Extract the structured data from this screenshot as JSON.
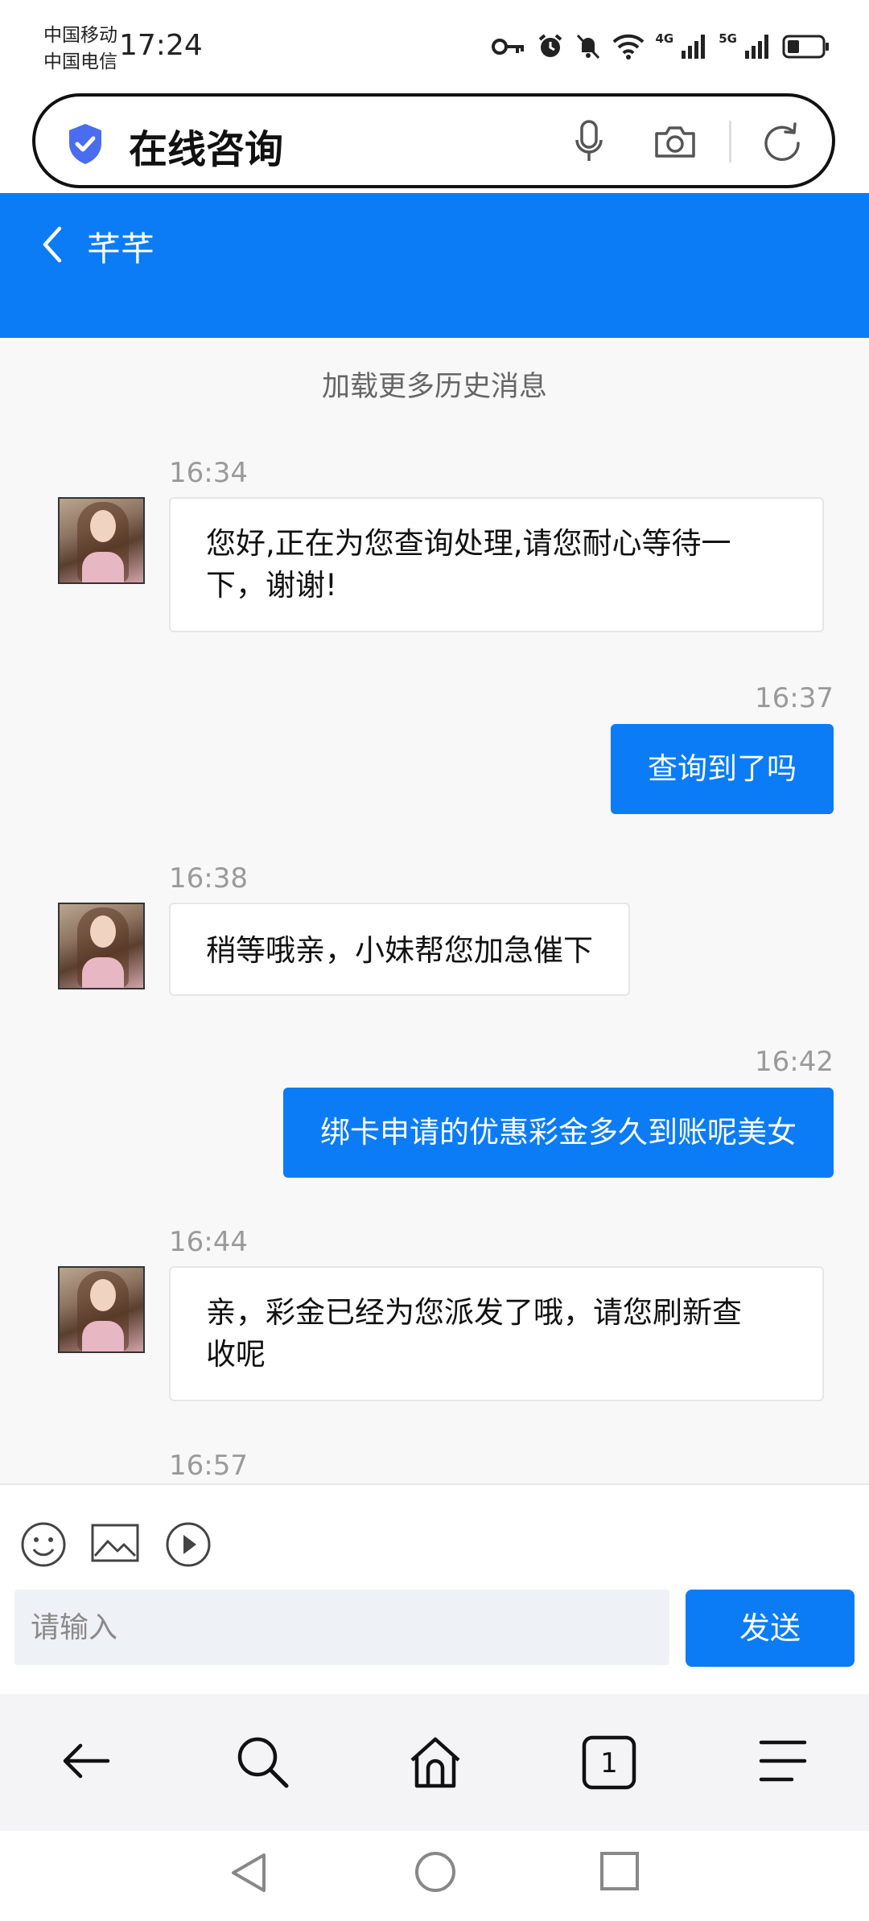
{
  "status_bar": {
    "carrier1": "中国移动",
    "carrier2": "中国电信",
    "time": "17:24",
    "net1": "4G",
    "net2": "5G"
  },
  "browser": {
    "url_text": "在线咨询"
  },
  "chat": {
    "title": "芊芊",
    "load_more": "加载更多历史消息",
    "messages": [
      {
        "from": "agent",
        "time": "16:34",
        "lines": [
          "您好,正在为您查询处理,请您耐心等待一",
          "下，谢谢!"
        ]
      },
      {
        "from": "user",
        "time": "16:37",
        "text": "查询到了吗"
      },
      {
        "from": "agent",
        "time": "16:38",
        "lines": [
          "稍等哦亲，小妹帮您加急催下"
        ]
      },
      {
        "from": "user",
        "time": "16:42",
        "text": "绑卡申请的优惠彩金多久到账呢美女"
      },
      {
        "from": "agent",
        "time": "16:44",
        "lines": [
          "亲，彩金已经为您派发了哦，请您刷新查",
          "收呢"
        ]
      },
      {
        "from": "agent",
        "time": "16:57"
      }
    ]
  },
  "composer": {
    "placeholder": "请输入",
    "send_label": "发送"
  },
  "browser_nav": {
    "tab_count": "1"
  },
  "colors": {
    "accent": "#0b7cf5",
    "chat_bg": "#f8f8f9"
  }
}
